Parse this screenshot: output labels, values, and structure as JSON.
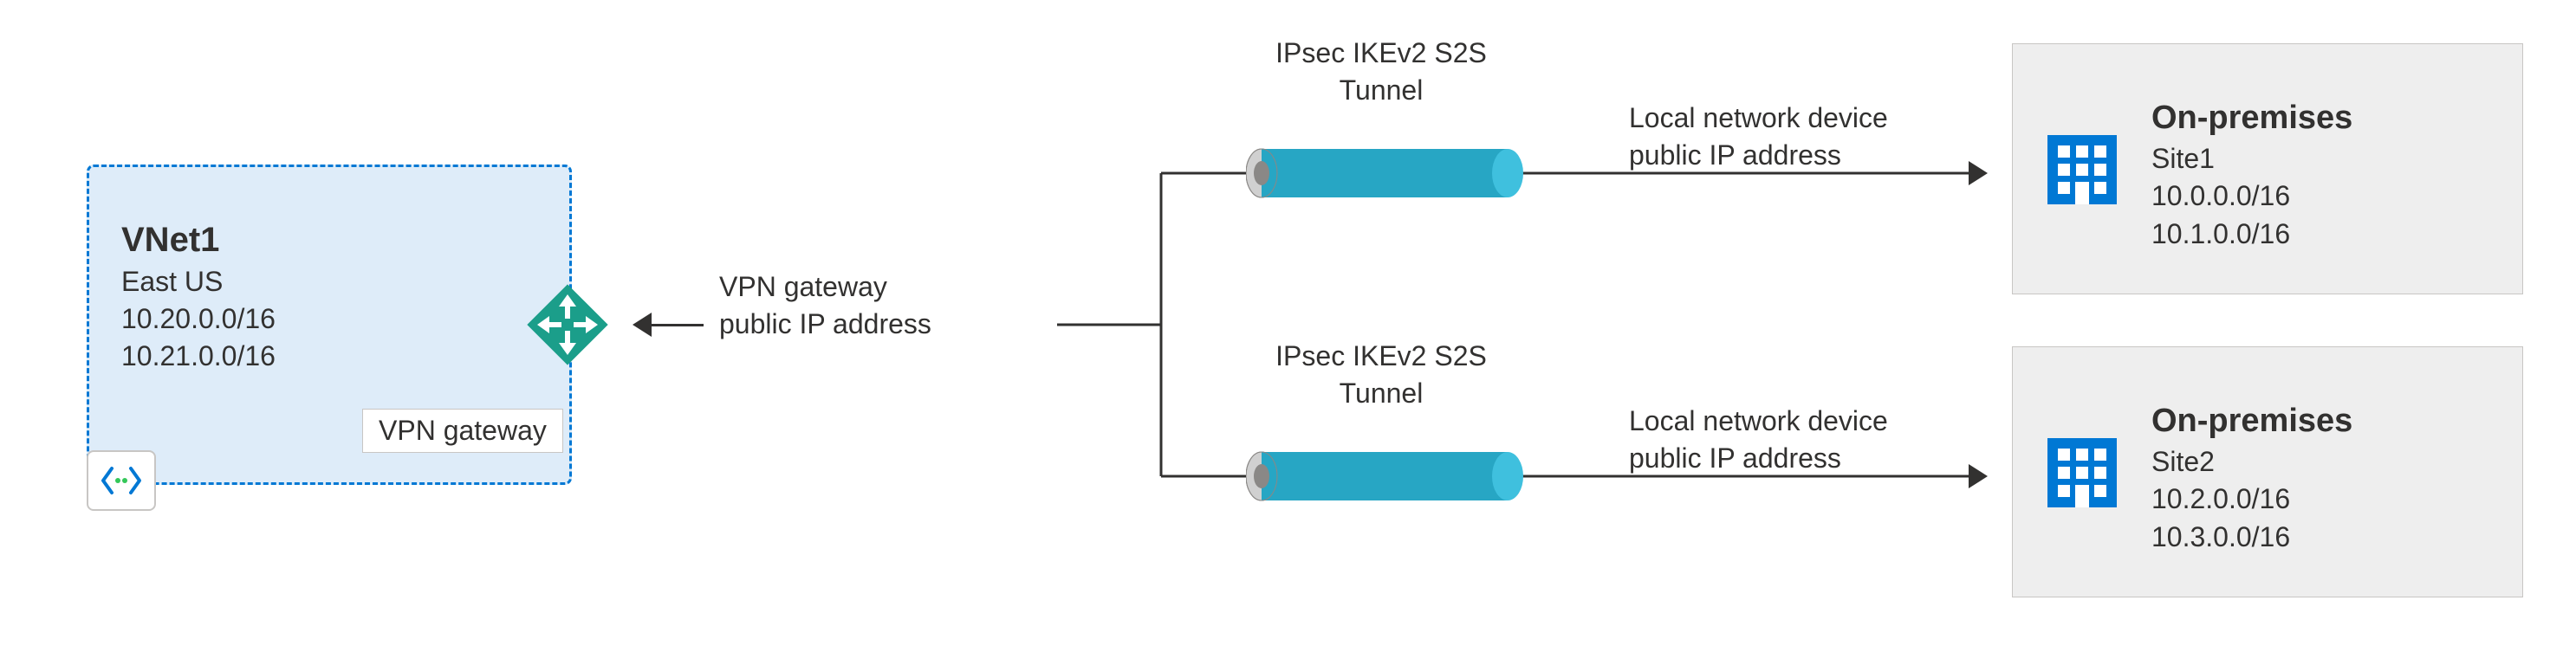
{
  "vnet": {
    "title": "VNet1",
    "region": "East US",
    "cidr1": "10.20.0.0/16",
    "cidr2": "10.21.0.0/16"
  },
  "gateway": {
    "label": "VPN gateway",
    "desc1": "VPN gateway",
    "desc2": "public IP address"
  },
  "tunnel": {
    "label1a": "IPsec IKEv2 S2S",
    "label1b": "Tunnel",
    "label2a": "IPsec IKEv2 S2S",
    "label2b": "Tunnel"
  },
  "localdev": {
    "l1a": "Local network device",
    "l1b": "public IP address",
    "l2a": "Local network device",
    "l2b": "public IP address"
  },
  "sites": {
    "s1": {
      "title": "On-premises",
      "name": "Site1",
      "cidr1": "10.0.0.0/16",
      "cidr2": "10.1.0.0/16"
    },
    "s2": {
      "title": "On-premises",
      "name": "Site2",
      "cidr1": "10.2.0.0/16",
      "cidr2": "10.3.0.0/16"
    }
  },
  "colors": {
    "azureBlue": "#0078d4",
    "tunnelTeal": "#27a6c4",
    "gatewayGreen": "#1b9e8a"
  }
}
